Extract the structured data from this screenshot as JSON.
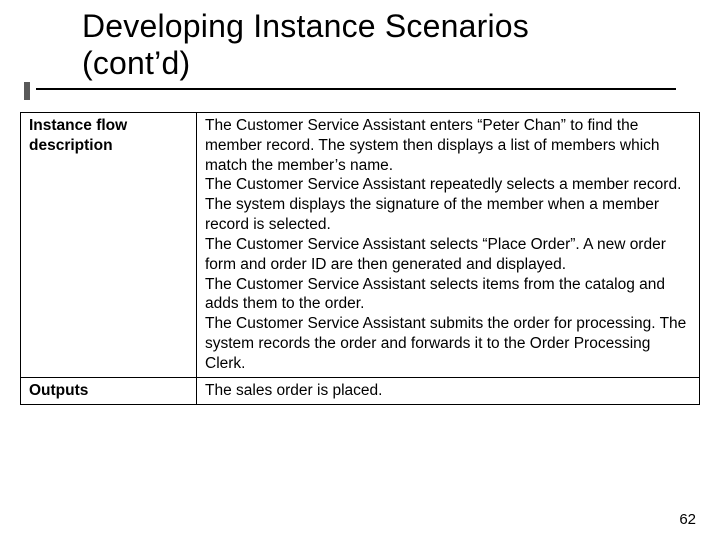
{
  "title": {
    "line1": "Developing Instance Scenarios",
    "line2": "(cont’d)"
  },
  "rows": [
    {
      "label_l1": "Instance flow",
      "label_l2": "description",
      "paragraphs": [
        "The Customer Service Assistant enters “Peter Chan” to find the member record. The system then displays a list of members which match the member’s name.",
        "The Customer Service Assistant repeatedly selects a member record. The system displays the signature of the member when a member record is selected.",
        "The Customer Service Assistant selects “Place Order”. A new order form and order ID are then generated and displayed.",
        "The Customer Service Assistant selects items from the catalog and adds them to the order.",
        "The Customer Service Assistant submits the order for processing. The system records the order and forwards it to the Order Processing Clerk."
      ]
    },
    {
      "label_l1": "Outputs",
      "label_l2": "",
      "paragraphs": [
        "The sales order is placed."
      ]
    }
  ],
  "page_number": "62"
}
